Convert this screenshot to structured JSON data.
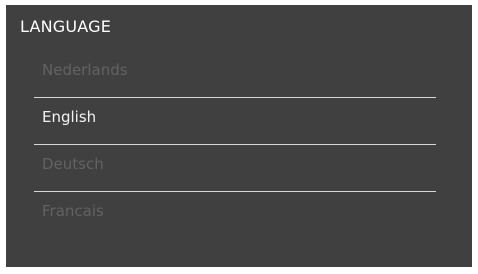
{
  "title": "LANGUAGE",
  "languages": [
    {
      "label": "Nederlands",
      "selected": false
    },
    {
      "label": "English",
      "selected": true
    },
    {
      "label": "Deutsch",
      "selected": false
    },
    {
      "label": "Francais",
      "selected": false
    }
  ],
  "colors": {
    "panel_bg": "#404040",
    "selected_text": "#f2f2f2",
    "unselected_text": "#626262",
    "divider": "#d6d6d6"
  }
}
